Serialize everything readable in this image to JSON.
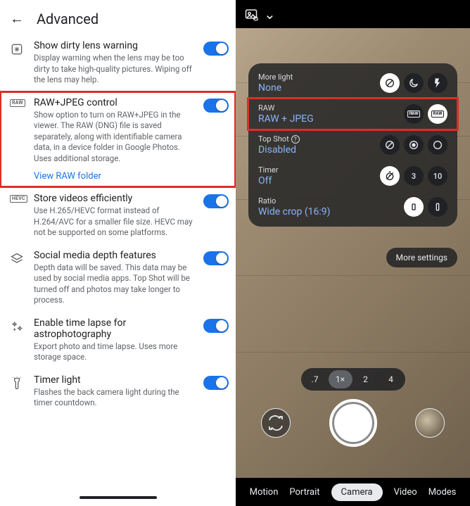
{
  "left": {
    "title": "Advanced",
    "items": [
      {
        "icon": "sparkle-icon",
        "title": "Show dirty lens warning",
        "desc": "Display warning when the lens may be too dirty to take high-quality pictures. Wiping off the lens may help."
      },
      {
        "icon": "raw-tag-icon",
        "title": "RAW+JPEG control",
        "desc": "Show option to turn on RAW+JPEG in the viewer. The RAW (DNG) file is saved separately, along with identifiable camera data, in a device folder in Google Photos. Uses additional storage.",
        "link": "View RAW folder",
        "highlight": true
      },
      {
        "icon": "hevc-tag-icon",
        "title": "Store videos efficiently",
        "desc": "Use H.265/HEVC format instead of H.264/AVC for a smaller file size. HEVC may not be supported on some platforms."
      },
      {
        "icon": "layers-icon",
        "title": "Social media depth features",
        "desc": "Depth data will be saved. This data may be used by social media apps. Top Shot will be turned off and photos may take longer to process."
      },
      {
        "icon": "sparkles-plus-icon",
        "title": "Enable time lapse for astrophotography",
        "desc": "Export photo and time lapse. Uses more storage space."
      },
      {
        "icon": "flashlight-icon",
        "title": "Timer light",
        "desc": "Flashes the back camera light during the timer countdown."
      }
    ]
  },
  "right": {
    "quick_settings": [
      {
        "label": "More light",
        "value": "None",
        "options": [
          {
            "name": "none-icon",
            "selected": true
          },
          {
            "name": "night-sight-icon",
            "selected": false
          },
          {
            "name": "flash-icon",
            "selected": false
          }
        ]
      },
      {
        "label": "RAW",
        "value": "RAW + JPEG",
        "highlight": true,
        "options": [
          {
            "name": "jpeg-only-icon",
            "selected": false
          },
          {
            "name": "raw-jpeg-icon",
            "selected": true
          }
        ]
      },
      {
        "label": "Top Shot",
        "value": "Disabled",
        "help": true,
        "options": [
          {
            "name": "topshot-off-icon",
            "selected": false
          },
          {
            "name": "topshot-auto-icon",
            "selected": false
          },
          {
            "name": "topshot-on-icon",
            "selected": false
          }
        ]
      },
      {
        "label": "Timer",
        "value": "Off",
        "options": [
          {
            "name": "timer-off-icon",
            "selected": true
          },
          {
            "name": "timer-3-icon",
            "text": "3",
            "selected": false
          },
          {
            "name": "timer-10-icon",
            "text": "10",
            "selected": false
          }
        ]
      },
      {
        "label": "Ratio",
        "value": "Wide crop (16:9)",
        "options": [
          {
            "name": "ratio-4-3-icon",
            "selected": true
          },
          {
            "name": "ratio-16-9-icon",
            "selected": false
          }
        ]
      }
    ],
    "more_settings": "More settings",
    "zoom": {
      "options": [
        ".7",
        "1×",
        "2",
        "4"
      ],
      "selected": "1×"
    },
    "modes": {
      "options": [
        "Motion",
        "Portrait",
        "Camera",
        "Video",
        "Modes"
      ],
      "selected": "Camera"
    }
  }
}
